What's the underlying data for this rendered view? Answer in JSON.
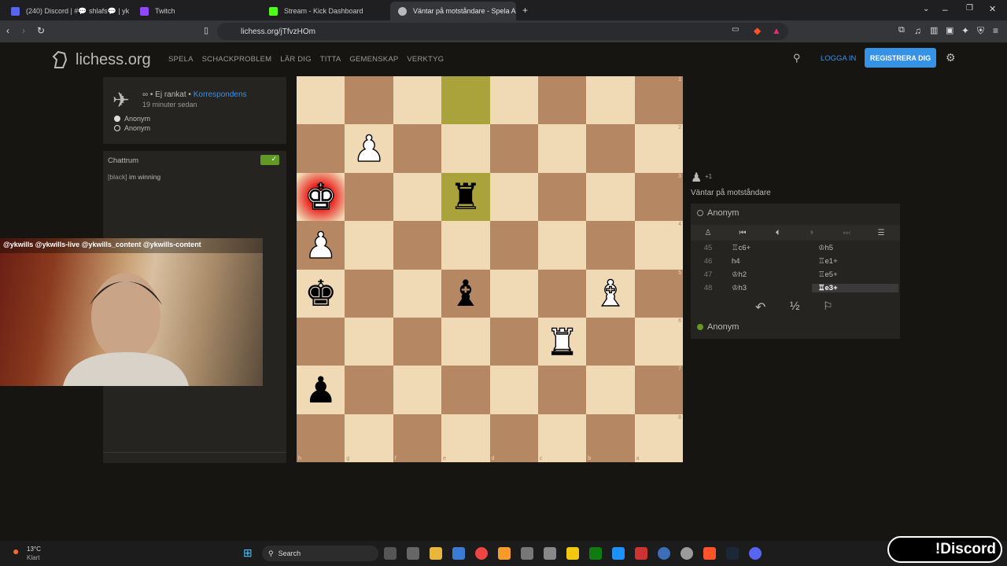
{
  "browser": {
    "tabs": [
      {
        "label": "(240) Discord | #💬 shlafs💬 | ykwills",
        "color": "#5865f2"
      },
      {
        "label": "Twitch",
        "color": "#9146ff"
      },
      {
        "label": "Stream - Kick Dashboard",
        "color": "#53fc18"
      },
      {
        "label": "Väntar på motståndare - Spela A",
        "color": "#bababa"
      }
    ],
    "url": "lichess.org/jTfvzHOm"
  },
  "site": {
    "logo": "lichess.org",
    "nav": [
      "SPELA",
      "SCHACKPROBLEM",
      "LÄR DIG",
      "TITTA",
      "GEMENSKAP",
      "VERKTYG"
    ],
    "login": "LOGGA IN",
    "register": "REGISTRERA DIG"
  },
  "game": {
    "type_line": "∞ • Ej rankat •",
    "mode": "Korrespondens",
    "time": "19 minuter sedan",
    "players": [
      "Anonym",
      "Anonym"
    ]
  },
  "chat": {
    "title": "Chattrum",
    "messages": [
      {
        "user": "[black]",
        "text": "im winning"
      }
    ]
  },
  "board": {
    "ranks": [
      "1",
      "2",
      "3",
      "4",
      "5",
      "6",
      "7",
      "8"
    ],
    "files": [
      "h",
      "g",
      "f",
      "e",
      "d",
      "c",
      "b",
      "a"
    ],
    "rows": [
      [
        "",
        "",
        "",
        "",
        "",
        "",
        "",
        ""
      ],
      [
        "",
        "wP",
        "",
        "",
        "",
        "",
        "",
        ""
      ],
      [
        "wK",
        "",
        "",
        "bR",
        "",
        "",
        "",
        ""
      ],
      [
        "wP",
        "",
        "",
        "",
        "",
        "",
        "",
        ""
      ],
      [
        "bK",
        "",
        "",
        "bB",
        "",
        "",
        "wB",
        ""
      ],
      [
        "",
        "",
        "",
        "",
        "",
        "wR",
        "",
        ""
      ],
      [
        "bP",
        "",
        "",
        "",
        "",
        "",
        "",
        ""
      ],
      [
        "",
        "",
        "",
        "",
        "",
        "",
        "",
        ""
      ]
    ],
    "highlight": [
      [
        0,
        3
      ],
      [
        2,
        3
      ]
    ],
    "check": [
      2,
      0
    ]
  },
  "side": {
    "material": "+1",
    "waiting": "Väntar på motståndare",
    "top_player": "Anonym",
    "bottom_player": "Anonym",
    "moves": [
      {
        "n": "45",
        "w": "♖c6+",
        "b": "♔h5"
      },
      {
        "n": "46",
        "w": "h4",
        "b": "♖e1+"
      },
      {
        "n": "47",
        "w": "♔h2",
        "b": "♖e5+"
      },
      {
        "n": "48",
        "w": "♔h3",
        "b": "♖e3+"
      }
    ],
    "draw": "½"
  },
  "webcam": {
    "overlay": "@ykwills  @ykwills-live  @ykwills_content  @ykwills-content"
  },
  "taskbar": {
    "weather_temp": "13°C",
    "weather_desc": "Klart",
    "search": "Search",
    "discord_badge": "!Discord"
  }
}
